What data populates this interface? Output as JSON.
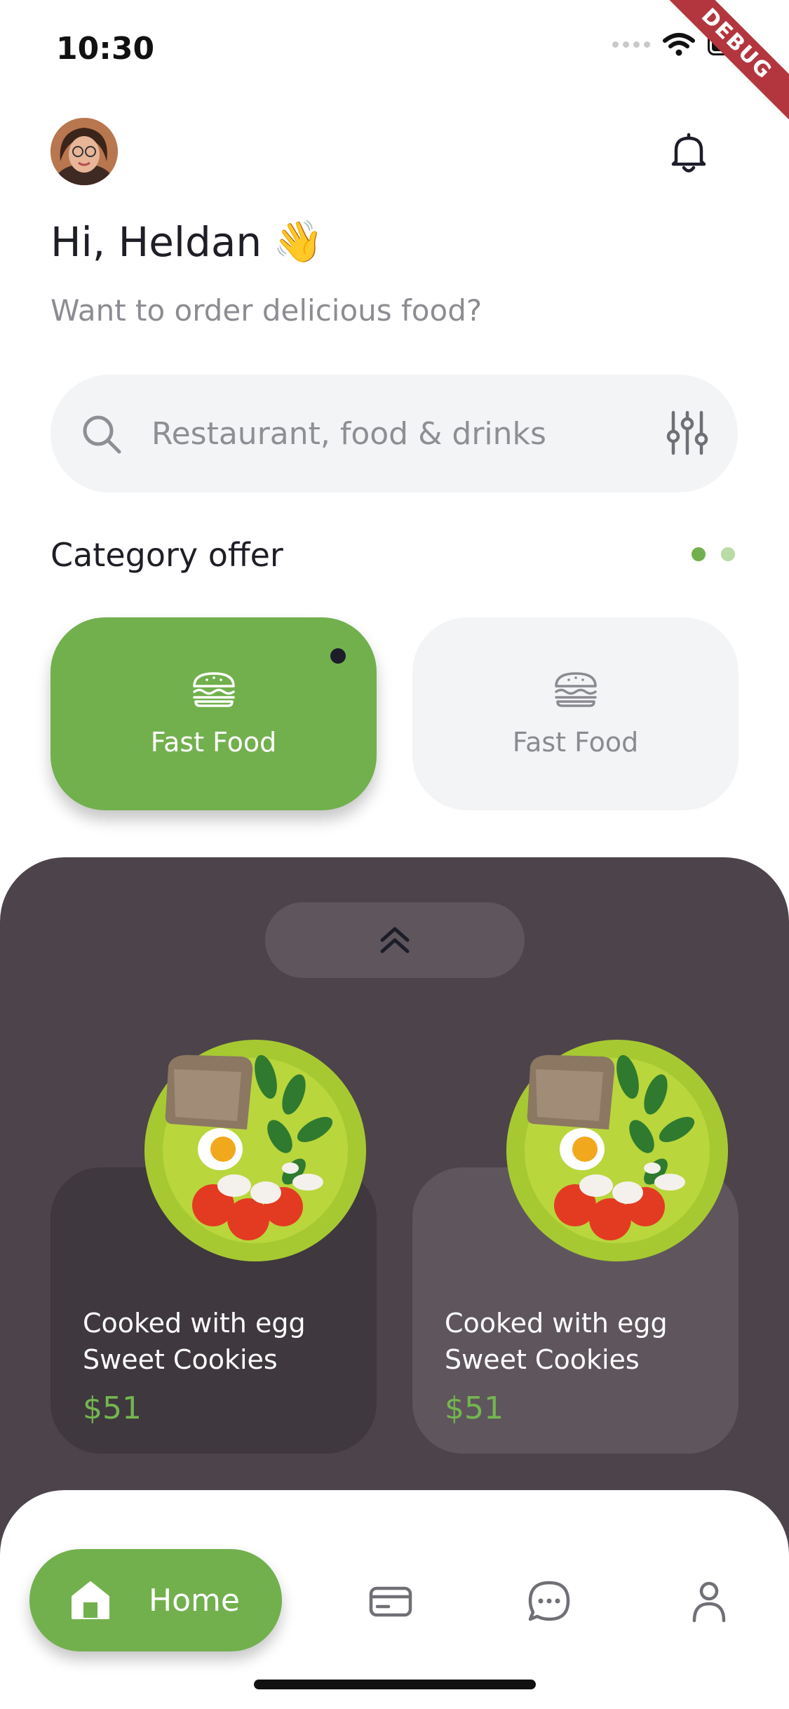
{
  "status_bar": {
    "time": "10:30",
    "debug_banner": "DEBUG"
  },
  "header": {
    "greeting": "Hi, Heldan",
    "greeting_emoji": "👋",
    "subtitle": "Want to order delicious food?"
  },
  "search": {
    "placeholder": "Restaurant, food & drinks",
    "value": ""
  },
  "category": {
    "title": "Category offer",
    "items": [
      {
        "label": "Fast Food",
        "icon": "burger-icon",
        "active": true
      },
      {
        "label": "Fast Food",
        "icon": "burger-icon",
        "active": false
      }
    ],
    "pager": {
      "pages": 2,
      "current": 1
    }
  },
  "foods": [
    {
      "name_line1": "Cooked with egg",
      "name_line2": "Sweet Cookies",
      "price": "$51"
    },
    {
      "name_line1": "Cooked with egg",
      "name_line2": "Sweet Cookies",
      "price": "$51"
    }
  ],
  "nav": {
    "items": [
      {
        "label": "Home",
        "icon": "home-icon",
        "active": true
      },
      {
        "icon": "card-icon"
      },
      {
        "icon": "chat-icon"
      },
      {
        "icon": "profile-icon"
      }
    ]
  },
  "colors": {
    "accent": "#72b04e",
    "panel": "#4d434a",
    "card_dark": "#3f383e",
    "card_light": "#5f565d",
    "surface": "#f3f4f6"
  }
}
